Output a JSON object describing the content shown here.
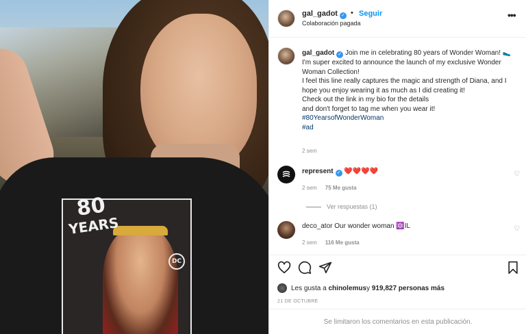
{
  "header": {
    "username": "gal_gadot",
    "separator": "•",
    "follow_label": "Seguir",
    "subtitle": "Colaboración pagada",
    "more_label": "•••"
  },
  "photo": {
    "print_number": "80",
    "print_years": "YEARS",
    "print_logo": "DC"
  },
  "caption": {
    "username": "gal_gadot",
    "lines": [
      " Join me in celebrating 80 years of Wonder Woman! 🥿",
      "I'm super excited to announce the launch of my exclusive Wonder Woman Collection!",
      "I feel this line really captures the magic and strength of Diana, and I hope you enjoy wearing it as much as I did creating it!",
      "Check out the link in my bio for the details",
      "and don't forget to tag me when you wear it!"
    ],
    "hashtags": [
      "#80YearsofWonderWoman",
      "#ad"
    ],
    "age": "2 sem"
  },
  "comments": [
    {
      "username": "represent",
      "verified": true,
      "text": "❤️❤️❤️❤️",
      "age": "2 sem",
      "likes": "75 Me gusta"
    },
    {
      "username": "deco_ator",
      "verified": false,
      "text": "Our wonder woman 🔯IL",
      "age": "2 sem",
      "likes": "116 Me gusta"
    }
  ],
  "replies_label": "Ver respuestas (1)",
  "actions": {
    "like_icon": "heart-outline-icon",
    "comment_icon": "comment-bubble-icon",
    "share_icon": "paper-plane-icon",
    "save_icon": "bookmark-icon"
  },
  "likes": {
    "prefix": "Les gusta a ",
    "user": "chinolemus",
    "middle": " y ",
    "count": "919,827 personas más"
  },
  "date": "21 DE OCTUBRE",
  "footer": "Se limitaron los comentarios en esta publicación.",
  "colors": {
    "link": "#0095f6",
    "hashtag": "#00376b",
    "verified": "#3897f0",
    "muted": "#8e8e8e"
  }
}
